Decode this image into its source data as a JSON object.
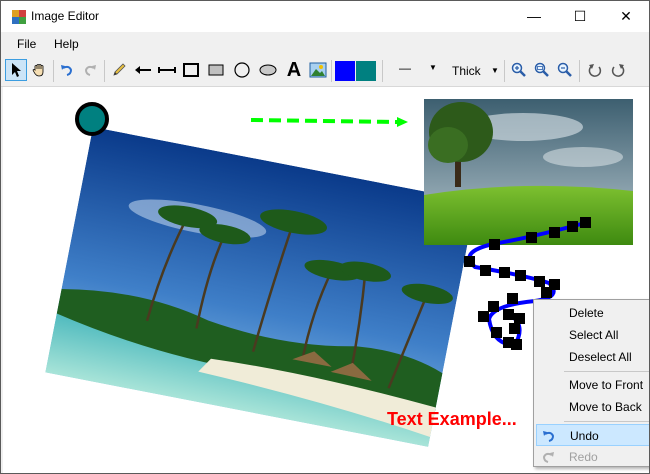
{
  "window": {
    "title": "Image Editor",
    "minimize_glyph": "—",
    "maximize_glyph": "☐",
    "close_glyph": "✕"
  },
  "menu": {
    "file": "File",
    "help": "Help"
  },
  "toolbar": {
    "line_style": "—",
    "thickness": "Thick",
    "fill_color": "#0000ff",
    "stroke_color": "#008080",
    "text_tool_glyph": "A",
    "icons": [
      "pointer-icon",
      "hand-icon",
      "undo-icon",
      "redo-icon",
      "pencil-icon",
      "arrow-icon",
      "line-icon",
      "rectangle-icon",
      "filled-rectangle-icon",
      "circle-icon",
      "ellipse-icon",
      "text-icon",
      "image-icon",
      "zoom-in-icon",
      "zoom-actual-icon",
      "zoom-out-icon",
      "rotate-left-icon",
      "rotate-right-icon"
    ]
  },
  "canvas": {
    "text_example": "Text Example...",
    "text_color": "#ff0000",
    "arrow_color": "#00ff00",
    "curve_color": "#0000ff",
    "circle_fill": "#008080"
  },
  "context_menu": {
    "items": [
      {
        "label": "Delete"
      },
      {
        "label": "Select All"
      },
      {
        "label": "Deselect All"
      },
      {
        "label": "Move to Front"
      },
      {
        "label": "Move to Back"
      },
      {
        "label": "Undo",
        "highlighted": true
      },
      {
        "label": "Redo",
        "disabled": true
      }
    ]
  }
}
